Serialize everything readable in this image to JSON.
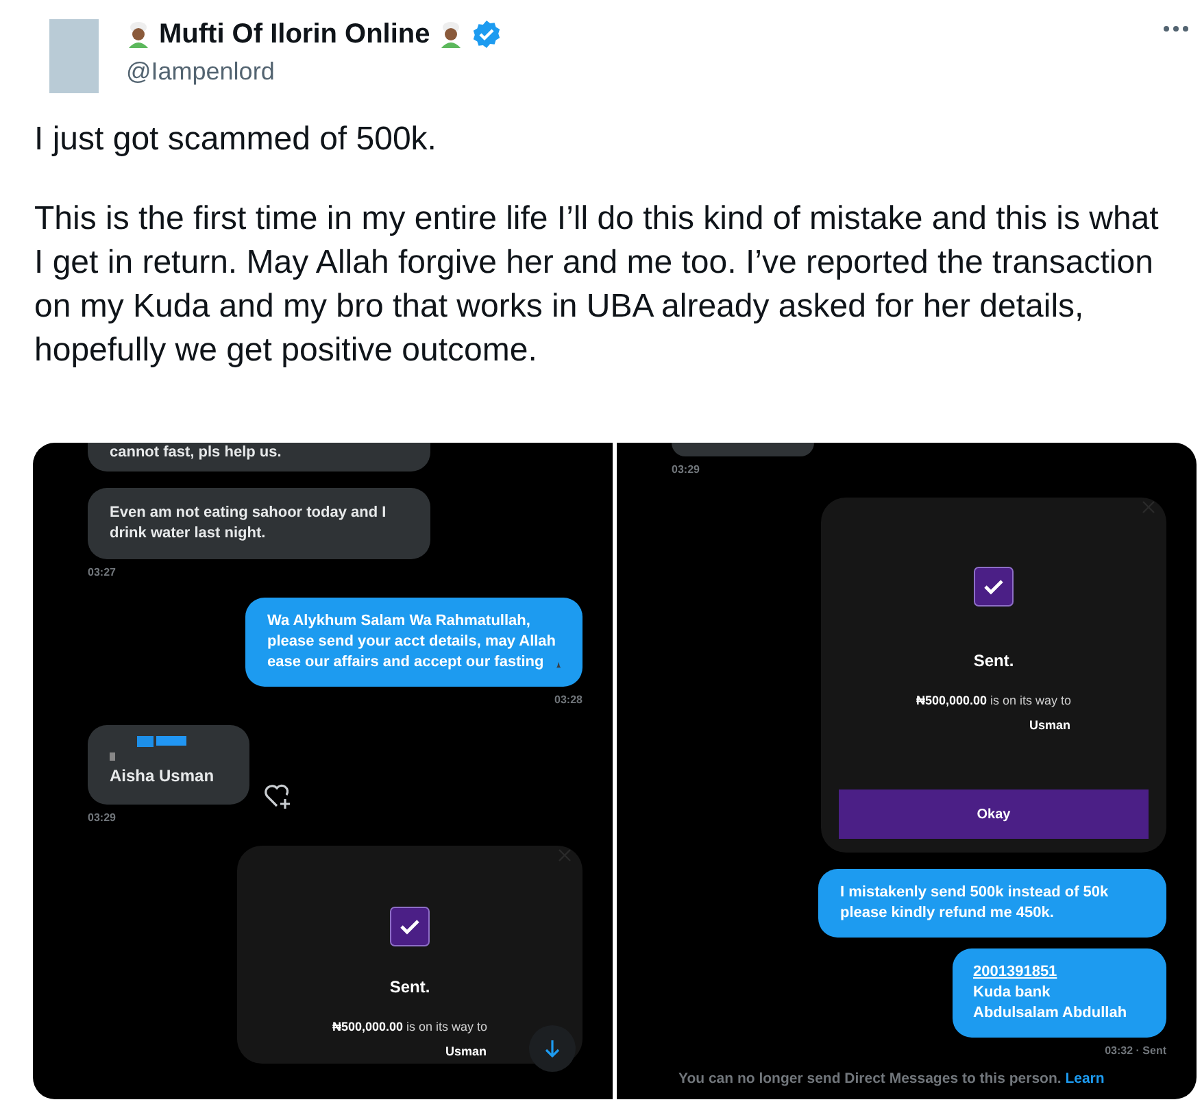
{
  "author": {
    "name": "Mufti Of Ilorin Online",
    "handle": "@Iampenlord",
    "verified": true
  },
  "paragraphs": [
    "I just got scammed of 500k.",
    "This is the first time in my entire life I’ll do this kind of mistake and this is what I get in return. May Allah forgive her and me too. I’ve reported the transaction on my Kuda and my bro that works in UBA already asked for her details, hopefully we get positive outcome."
  ],
  "media": [
    {
      "items": [
        {
          "kind": "incoming",
          "text": "cannot fast, pls help us."
        },
        {
          "kind": "incoming",
          "text": "Even am not eating sahoor today and I drink water last night."
        },
        {
          "kind": "timestamp",
          "text": "03:27"
        },
        {
          "kind": "outgoing",
          "text": "Wa Alykhum Salam Wa Rahmatullah, please send your acct details, may Allah ease our affairs and accept our fasting"
        },
        {
          "kind": "timestamp_right",
          "text": "03:28"
        },
        {
          "kind": "contact",
          "text": "Aisha Usman"
        },
        {
          "kind": "timestamp",
          "text": "03:29"
        },
        {
          "kind": "transfer",
          "title": "Sent.",
          "amount": "₦500,000.00",
          "rest": "is on its way to",
          "recipient": "Usman"
        }
      ],
      "scroll_button": true
    },
    {
      "items": [
        {
          "kind": "stub"
        },
        {
          "kind": "timestamp",
          "text": "03:29"
        },
        {
          "kind": "transfer",
          "title": "Sent.",
          "amount": "₦500,000.00",
          "rest": "is on its way to",
          "recipient": "Usman",
          "button": "Okay"
        },
        {
          "kind": "outgoing",
          "text": "I mistakenly send 500k instead of 50k please kindly refund me 450k."
        },
        {
          "kind": "account",
          "number": "2001391851",
          "lines": [
            "Kuda bank",
            "Abdulsalam Abdullah"
          ]
        },
        {
          "kind": "timestamp_right",
          "text": "03:32 · Sent"
        },
        {
          "kind": "notice",
          "text": "You can no longer send Direct Messages to this person.",
          "link": "Learn"
        }
      ],
      "scroll_button": false
    }
  ]
}
